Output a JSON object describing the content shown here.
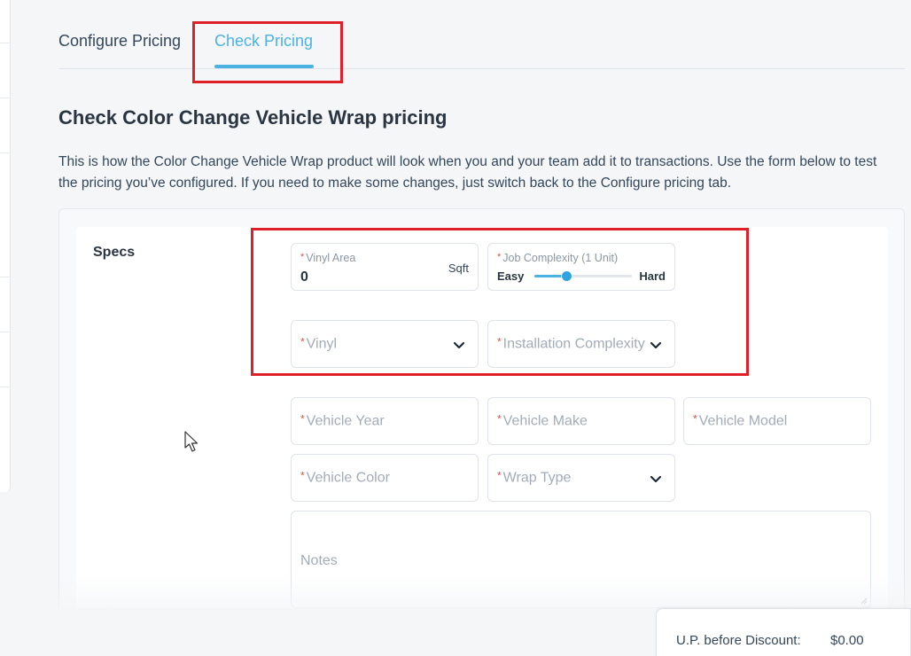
{
  "tabs": [
    {
      "label": "Configure Pricing",
      "active": false
    },
    {
      "label": "Check Pricing",
      "active": true
    }
  ],
  "heading": "Check Color Change Vehicle Wrap pricing",
  "description": "This is how the Color Change Vehicle Wrap product will look when you and your team add it to transactions. Use the form below to test the pricing you’ve configured. If you need to make some changes, just switch back to the Configure pricing tab.",
  "specs": {
    "section_label": "Specs",
    "required_marker": "*",
    "vinyl_area": {
      "label": "Vinyl Area",
      "value": "0",
      "unit": "Sqft"
    },
    "job_complexity": {
      "label": "Job Complexity (1 Unit)",
      "min_label": "Easy",
      "max_label": "Hard",
      "level": 0.33
    },
    "vinyl": {
      "placeholder": "Vinyl",
      "icon": "chevron-down-icon"
    },
    "installation_complexity": {
      "placeholder": "Installation Complexity",
      "icon": "chevron-down-icon"
    },
    "vehicle_year": {
      "placeholder": "Vehicle Year"
    },
    "vehicle_make": {
      "placeholder": "Vehicle Make"
    },
    "vehicle_model": {
      "placeholder": "Vehicle Model"
    },
    "vehicle_color": {
      "placeholder": "Vehicle Color"
    },
    "wrap_type": {
      "placeholder": "Wrap Type",
      "icon": "chevron-down-icon"
    },
    "notes": {
      "placeholder": "Notes"
    }
  },
  "summary": {
    "label": "U.P. before Discount:",
    "value": "$0.00"
  },
  "colors": {
    "accent": "#4bb3e3",
    "highlight": "#e02028",
    "required": "#d9534f",
    "text": "#33475b"
  }
}
